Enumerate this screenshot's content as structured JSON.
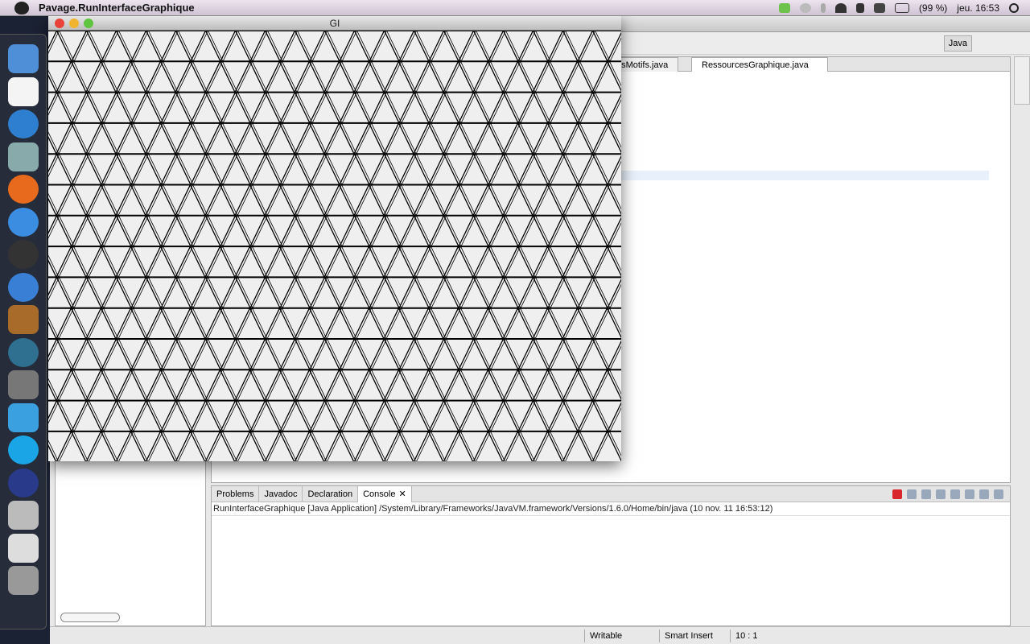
{
  "menubar": {
    "app_name": "Pavage.RunInterfaceGraphique",
    "battery": "(99 %)",
    "clock": "jeu. 16:53"
  },
  "dock": {
    "items": [
      "finder",
      "x11",
      "app-store",
      "preview",
      "firefox",
      "safari",
      "dashboard",
      "itunes",
      "iphoto",
      "time-machine",
      "system-preferences",
      "messenger",
      "skype",
      "eclipse",
      "calculator",
      "script-editor",
      "trash"
    ]
  },
  "eclipse": {
    "title": "clipse SDK – /Users/Mikihsa/IK3",
    "perspective": "Java",
    "editor_tabs": [
      "esMotifs.java",
      "RessourcesGraphique.java"
    ],
    "console_tabs": [
      "Problems",
      "Javadoc",
      "Declaration",
      "Console"
    ],
    "console_launch": "RunInterfaceGraphique [Java Application] /System/Library/Frameworks/JavaVM.framework/Versions/1.6.0/Home/bin/java (10 nov. 11 16:53:12)",
    "status": {
      "mode": "Writable",
      "insert": "Smart Insert",
      "position": "10 : 1"
    }
  },
  "gi_window": {
    "title": "GI"
  },
  "colors": {
    "tile_fill": "#efefef",
    "stroke": "#000000",
    "close": "#e8423a",
    "min": "#f0b430",
    "max": "#5fc440"
  }
}
